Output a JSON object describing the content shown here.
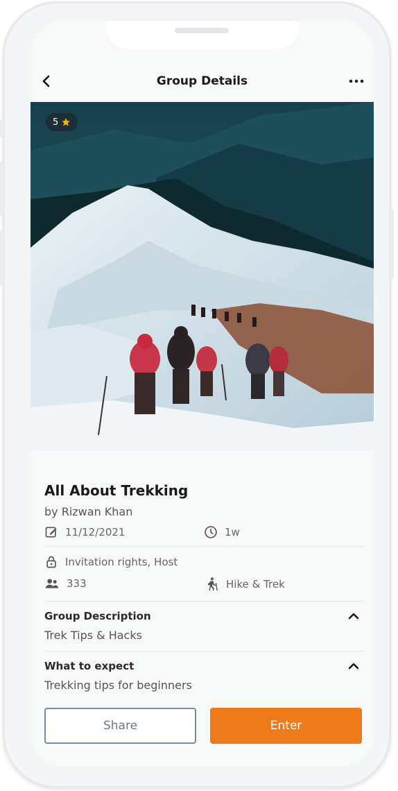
{
  "header": {
    "title": "Group Details"
  },
  "hero": {
    "rating": "5",
    "rating_icon": "star-icon"
  },
  "group": {
    "name": "All About Trekking",
    "author": "by Rizwan Khan",
    "date": "11/12/2021",
    "duration": "1w",
    "rights": "Invitation rights, Host",
    "members": "333",
    "category": "Hike & Trek"
  },
  "sections": [
    {
      "title": "Group Description",
      "body": "Trek Tips & Hacks"
    },
    {
      "title": "What to expect",
      "body": "Trekking tips for beginners"
    }
  ],
  "actions": {
    "share_label": "Share",
    "enter_label": "Enter"
  },
  "colors": {
    "accent": "#ee7a1a",
    "share_border": "#7c8a96",
    "star": "#f5b400"
  }
}
